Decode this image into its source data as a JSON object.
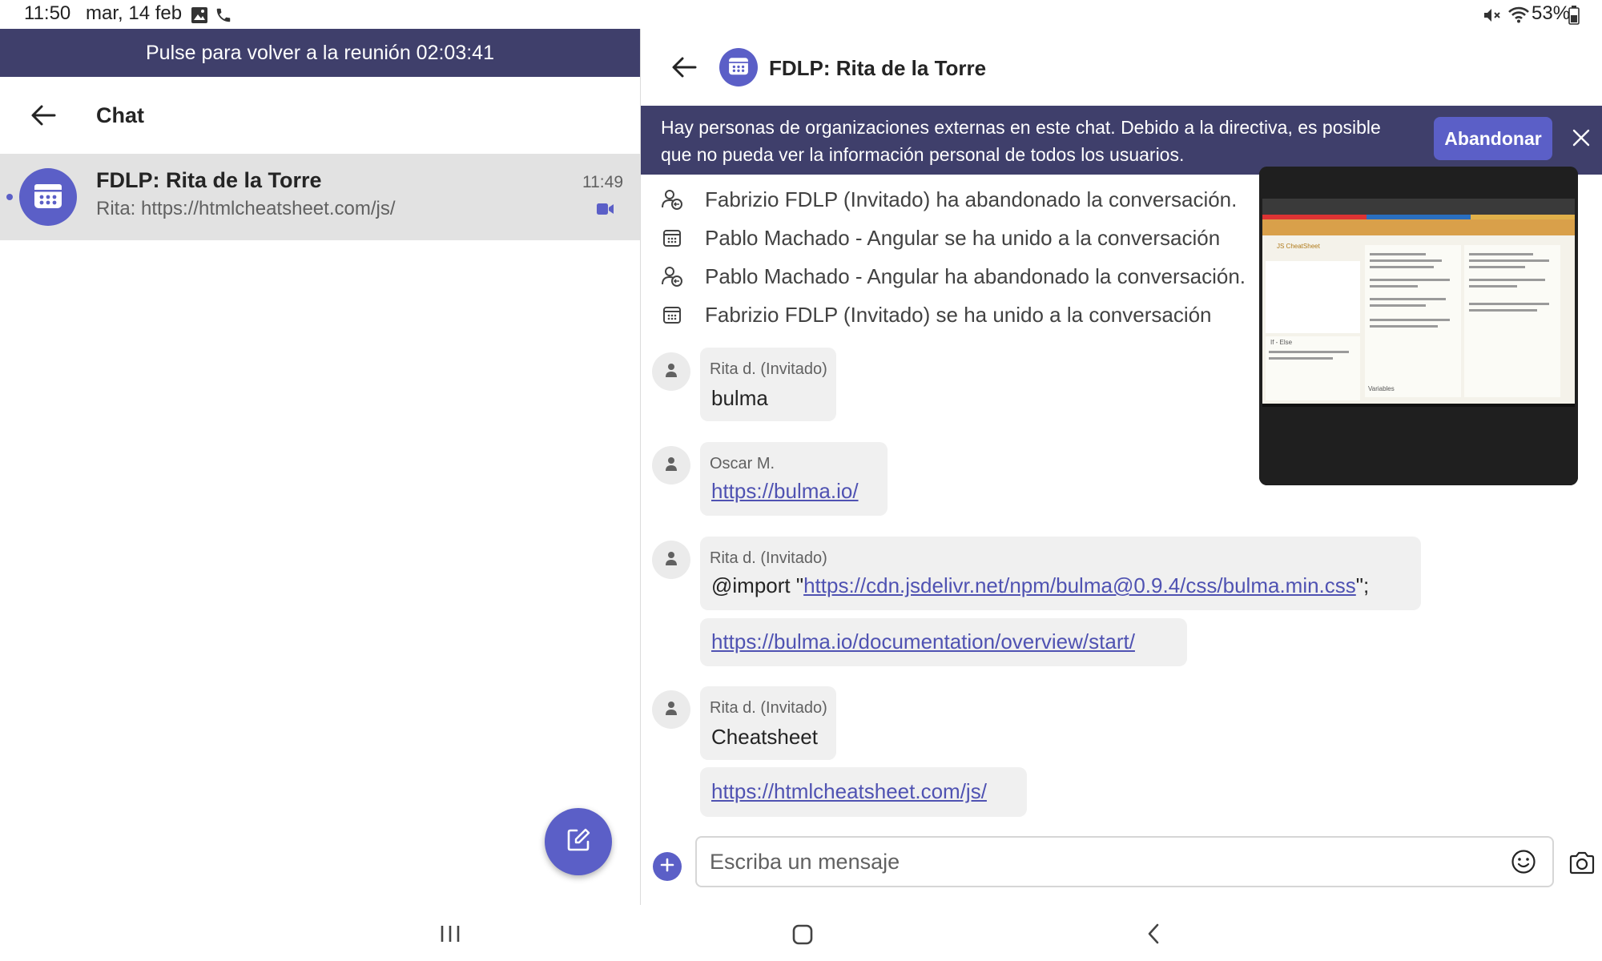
{
  "status_bar": {
    "time": "11:50",
    "date": "mar, 14 feb",
    "battery": "53%"
  },
  "left_pane": {
    "meeting_banner": "Pulse para volver a la reunión 02:03:41",
    "header_title": "Chat",
    "chat_item": {
      "title": "FDLP: Rita de la Torre",
      "preview": "Rita: https://htmlcheatsheet.com/js/",
      "time": "11:49"
    }
  },
  "conversation": {
    "title": "FDLP: Rita de la Torre",
    "external_banner": {
      "text": "Hay personas de organizaciones externas en este chat. Debido a la directiva, es posible que no pueda ver la información personal de todos los usuarios.",
      "leave_label": "Abandonar"
    },
    "system_events": [
      {
        "icon": "person-left-icon",
        "text": "Fabrizio FDLP (Invitado) ha abandonado la conversación."
      },
      {
        "icon": "calendar-icon",
        "text": "Pablo Machado - Angular se ha unido a la conversación"
      },
      {
        "icon": "person-left-icon",
        "text": "Pablo Machado - Angular ha abandonado la conversación."
      },
      {
        "icon": "calendar-icon",
        "text": "Fabrizio FDLP (Invitado) se ha unido a la conversación"
      }
    ],
    "messages": [
      {
        "sender": "Rita d. (Invitado)",
        "text": "bulma"
      },
      {
        "sender": "Oscar M.",
        "link": "https://bulma.io/"
      },
      {
        "sender": "Rita d. (Invitado)",
        "prefix": "@import \"",
        "link": "https://cdn.jsdelivr.net/npm/bulma@0.9.4/css/bulma.min.css",
        "suffix": "\";"
      },
      {
        "link": "https://bulma.io/documentation/overview/start/"
      },
      {
        "sender": "Rita d. (Invitado)",
        "text": "Cheatsheet"
      },
      {
        "link": "https://htmlcheatsheet.com/js/"
      }
    ],
    "composer_placeholder": "Escriba un mensaje",
    "shared_screen": {
      "app_title": "JS CheatSheet",
      "section_if_else": "If - Else",
      "section_variables": "Variables"
    }
  },
  "colors": {
    "brand": "#5b5fc7",
    "banner": "#3f3f6b",
    "link": "#4f52b2"
  }
}
